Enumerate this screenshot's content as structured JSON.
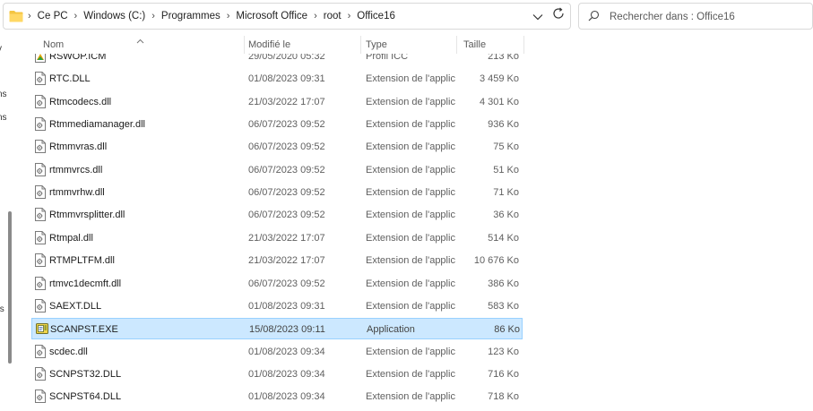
{
  "address": {
    "crumbs": [
      "Ce PC",
      "Windows (C:)",
      "Programmes",
      "Microsoft Office",
      "root",
      "Office16"
    ]
  },
  "search": {
    "placeholder": "Rechercher dans : Office16"
  },
  "nav_fragments": [
    "v",
    "ns",
    "ns",
    "ts"
  ],
  "columns": {
    "name": "Nom",
    "modified": "Modifié le",
    "type": "Type",
    "size": "Taille"
  },
  "files": [
    {
      "name": "RSWOP.ICM",
      "modified": "29/05/2020 05:32",
      "type": "Profil ICC",
      "size": "213 Ko",
      "icon": "icc-profile-icon"
    },
    {
      "name": "RTC.DLL",
      "modified": "01/08/2023 09:31",
      "type": "Extension de l'applica...",
      "size": "3 459 Ko",
      "icon": "dll-file-icon"
    },
    {
      "name": "Rtmcodecs.dll",
      "modified": "21/03/2022 17:07",
      "type": "Extension de l'applica...",
      "size": "4 301 Ko",
      "icon": "dll-file-icon"
    },
    {
      "name": "Rtmmediamanager.dll",
      "modified": "06/07/2023 09:52",
      "type": "Extension de l'applica...",
      "size": "936 Ko",
      "icon": "dll-file-icon"
    },
    {
      "name": "Rtmmvras.dll",
      "modified": "06/07/2023 09:52",
      "type": "Extension de l'applica...",
      "size": "75 Ko",
      "icon": "dll-file-icon"
    },
    {
      "name": "rtmmvrcs.dll",
      "modified": "06/07/2023 09:52",
      "type": "Extension de l'applica...",
      "size": "51 Ko",
      "icon": "dll-file-icon"
    },
    {
      "name": "rtmmvrhw.dll",
      "modified": "06/07/2023 09:52",
      "type": "Extension de l'applica...",
      "size": "71 Ko",
      "icon": "dll-file-icon"
    },
    {
      "name": "Rtmmvrsplitter.dll",
      "modified": "06/07/2023 09:52",
      "type": "Extension de l'applica...",
      "size": "36 Ko",
      "icon": "dll-file-icon"
    },
    {
      "name": "Rtmpal.dll",
      "modified": "21/03/2022 17:07",
      "type": "Extension de l'applica...",
      "size": "514 Ko",
      "icon": "dll-file-icon"
    },
    {
      "name": "RTMPLTFM.dll",
      "modified": "21/03/2022 17:07",
      "type": "Extension de l'applica...",
      "size": "10 676 Ko",
      "icon": "dll-file-icon"
    },
    {
      "name": "rtmvc1decmft.dll",
      "modified": "06/07/2023 09:52",
      "type": "Extension de l'applica...",
      "size": "386 Ko",
      "icon": "dll-file-icon"
    },
    {
      "name": "SAEXT.DLL",
      "modified": "01/08/2023 09:31",
      "type": "Extension de l'applica...",
      "size": "583 Ko",
      "icon": "dll-file-icon"
    },
    {
      "name": "SCANPST.EXE",
      "modified": "15/08/2023 09:11",
      "type": "Application",
      "size": "86 Ko",
      "icon": "scanpst-app-icon",
      "selected": true
    },
    {
      "name": "scdec.dll",
      "modified": "01/08/2023 09:34",
      "type": "Extension de l'applica...",
      "size": "123 Ko",
      "icon": "dll-file-icon"
    },
    {
      "name": "SCNPST32.DLL",
      "modified": "01/08/2023 09:34",
      "type": "Extension de l'applica...",
      "size": "716 Ko",
      "icon": "dll-file-icon"
    },
    {
      "name": "SCNPST64.DLL",
      "modified": "01/08/2023 09:34",
      "type": "Extension de l'applica...",
      "size": "718 Ko",
      "icon": "dll-file-icon"
    }
  ],
  "colors": {
    "selection_bg": "#cce8ff",
    "selection_border": "#99d1ff",
    "folder": "#f4c542"
  }
}
